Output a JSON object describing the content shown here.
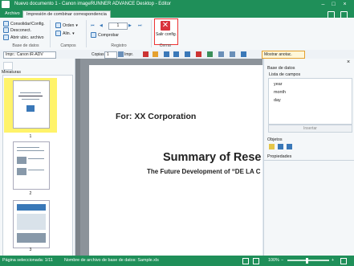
{
  "window": {
    "title": "Nuevo documento 1 - Canon imageRUNNER ADVANCE Desktop - Editor",
    "minimize": "–",
    "maximize": "□",
    "close": "×"
  },
  "tabs": [
    {
      "label": "Archivo"
    },
    {
      "label": "Impresión de combinar correspondencia"
    }
  ],
  "ribbon": {
    "base_datos": {
      "consolidar": "Consolidar/Config.",
      "desconectar": "Desconect.",
      "abrir": "Abrir ubic. archivo",
      "label": "Base de datos"
    },
    "campos": {
      "orden": "Orden",
      "alin": "Alin.",
      "label": "Campos"
    },
    "registro": {
      "value": "1",
      "comprobar": "Comprobar",
      "label": "Registro"
    },
    "cerrar": {
      "salir": "Salir config.",
      "label": "Cerrar"
    }
  },
  "toolbar2": {
    "printer": "Impr.: Canon iR-ADV",
    "copias_label": "Copias",
    "copias_value": "1",
    "impr_label": "Impr.",
    "mostrar": "Mostrar anotac."
  },
  "left_panel": {
    "header": "Miniaturas",
    "pages": [
      "1",
      "2",
      "3"
    ]
  },
  "document": {
    "for_line": "For: XX Corporation",
    "title": "Summary of Rese",
    "subtitle": "The Future Development of “DE LA C"
  },
  "right_panel": {
    "base_datos": "Base de datos",
    "lista_campos": "Lista de campos",
    "fields": [
      "year",
      "month",
      "day"
    ],
    "insertar": "Insertar",
    "objetos": "Objetos",
    "propiedades": "Propiedades"
  },
  "status": {
    "pagina": "Página seleccionada: 1/11",
    "archivo": "Nombre de archivo de base de datos: Sample.xls",
    "zoom": "100%"
  },
  "colors": {
    "accent": "#1f8f59",
    "selected_thumb": "#fff36a",
    "exit_red": "#d9323c"
  }
}
